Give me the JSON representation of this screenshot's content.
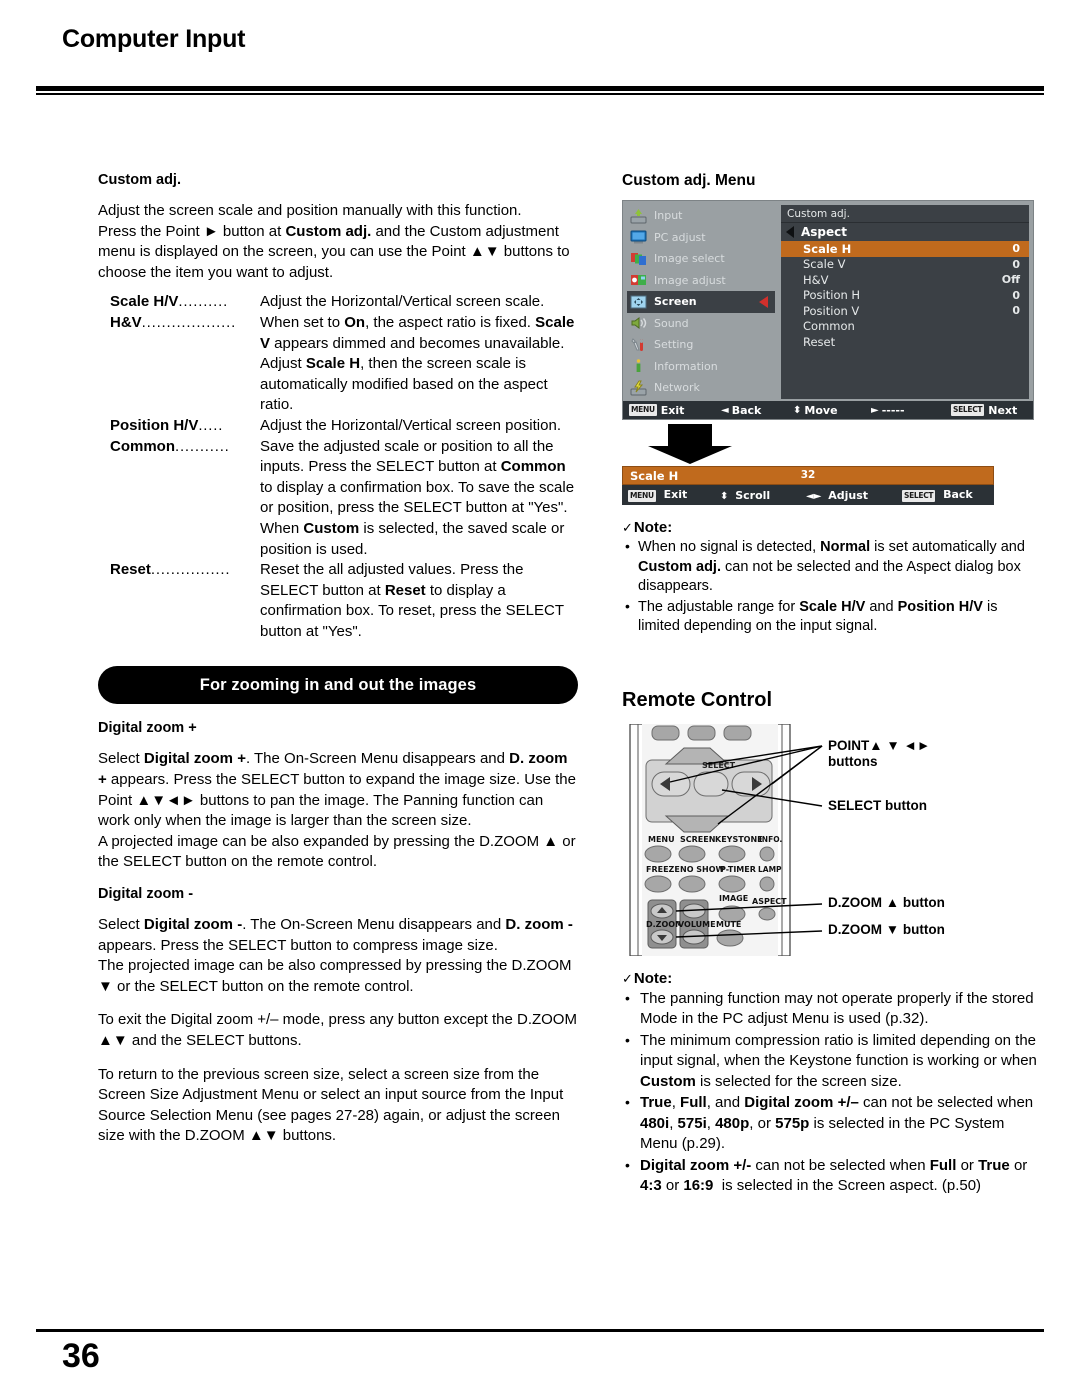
{
  "header": {
    "title": "Computer Input"
  },
  "footer": {
    "page_number": "36"
  },
  "left": {
    "custom_adj": {
      "heading": "Custom adj.",
      "p1": "Adjust the screen scale and position manually with this function.",
      "p2_pre": "Press the Point ► button at ",
      "p2_bold": "Custom adj.",
      "p2_post": " and the Custom adjustment menu is displayed on the screen, you can use the Point ▲▼ buttons to choose the item you want to adjust.",
      "items": [
        {
          "term": "Scale H/V",
          "dots": "..........",
          "desc": "Adjust the Horizontal/Vertical screen scale."
        },
        {
          "term": "H&V",
          "dots": "...................",
          "desc": "When set to On, the aspect ratio is fixed. Scale V appears dimmed and becomes unavailable. Adjust Scale H, then the screen scale is automatically modified based on the aspect ratio."
        },
        {
          "term": "Position H/V",
          "dots": ".....",
          "desc": "Adjust the Horizontal/Vertical screen position."
        },
        {
          "term": "Common",
          "dots": "...........",
          "desc": "Save the adjusted scale or position to all the inputs. Press the SELECT button at Common to display a confirmation box. To save the scale or position, press the SELECT button at \"Yes\". When Custom is selected, the saved scale or position is used."
        },
        {
          "term": "Reset",
          "dots": "................",
          "desc": "Reset the all adjusted values. Press the SELECT button at Reset to display a confirmation box. To reset, press the SELECT button at \"Yes\"."
        }
      ]
    },
    "banner": "For zooming in and out the images",
    "dzoom_plus": {
      "heading": "Digital zoom +",
      "p1": "Select Digital zoom +. The On-Screen Menu disappears and D. zoom + appears. Press the SELECT button to expand the image size. Use the Point ▲▼◄► buttons to pan the image. The Panning function can work only when the image is larger than the screen size.",
      "p2": "A projected image can be also expanded by pressing the D.ZOOM ▲ or the SELECT button on the remote control."
    },
    "dzoom_minus": {
      "heading": "Digital zoom -",
      "p1": "Select Digital zoom -. The On-Screen Menu disappears and D. zoom - appears. Press the SELECT button to compress image size.",
      "p2": "The projected image can be also compressed by pressing the D.ZOOM ▼ or the SELECT button on the remote control.",
      "p3": "To exit the Digital zoom +/– mode, press any button except the D.ZOOM ▲▼ and the SELECT buttons.",
      "p4": "To return to the previous screen size, select a screen size from the Screen Size Adjustment Menu or select an input source from the Input Source Selection Menu (see pages 27-28) again, or adjust the screen size with the D.ZOOM ▲▼ buttons."
    }
  },
  "right": {
    "osd_caption": "Custom adj. Menu",
    "osd": {
      "accent_color": "#c06a1d",
      "panel_color": "#3b4045",
      "frame_color": "#9aa0a3",
      "sidebar": [
        {
          "label": "Input",
          "icon": "input-icon",
          "active": false
        },
        {
          "label": "PC adjust",
          "icon": "monitor-icon",
          "active": false
        },
        {
          "label": "Image select",
          "icon": "image-select-icon",
          "active": false
        },
        {
          "label": "Image adjust",
          "icon": "image-adjust-icon",
          "active": false
        },
        {
          "label": "Screen",
          "icon": "screen-icon",
          "active": true
        },
        {
          "label": "Sound",
          "icon": "speaker-icon",
          "active": false
        },
        {
          "label": "Setting",
          "icon": "tools-icon",
          "active": false
        },
        {
          "label": "Information",
          "icon": "info-icon",
          "active": false
        },
        {
          "label": "Network",
          "icon": "network-icon",
          "active": false
        }
      ],
      "panel_title": "Custom adj.",
      "tab_label": "Aspect",
      "rows": [
        {
          "label": "Scale H",
          "value": "0",
          "selected": true
        },
        {
          "label": "Scale V",
          "value": "0",
          "selected": false
        },
        {
          "label": "H&V",
          "value": "Off",
          "selected": false
        },
        {
          "label": "Position H",
          "value": "0",
          "selected": false
        },
        {
          "label": "Position V",
          "value": "0",
          "selected": false
        },
        {
          "label": "Common",
          "value": "",
          "selected": false
        },
        {
          "label": "Reset",
          "value": "",
          "selected": false
        }
      ],
      "footbar": [
        {
          "key": "MENU",
          "glyph": "",
          "label": "Exit"
        },
        {
          "key": "",
          "glyph": "◄",
          "label": "Back"
        },
        {
          "key": "",
          "glyph": "⬍",
          "label": "Move"
        },
        {
          "key": "",
          "glyph": "►",
          "label": "-----"
        },
        {
          "key": "SELECT",
          "glyph": "",
          "label": "Next"
        }
      ]
    },
    "adjbar": {
      "label": "Scale H",
      "value": "32",
      "footbar": [
        {
          "key": "MENU",
          "glyph": "",
          "label": "Exit"
        },
        {
          "key": "",
          "glyph": "⬍",
          "label": "Scroll"
        },
        {
          "key": "",
          "glyph": "◄►",
          "label": "Adjust"
        },
        {
          "key": "SELECT",
          "glyph": "",
          "label": "Back"
        }
      ]
    },
    "note1": {
      "title": "Note:",
      "check": "✓",
      "items": [
        "When no signal is detected, Normal is set automatically and Custom adj. can not be selected and the Aspect dialog box disappears.",
        "The adjustable range for Scale H/V and Position H/V is limited depending on the input signal."
      ]
    },
    "remote_heading": "Remote Control",
    "remote": {
      "callouts": [
        {
          "id": "point",
          "text": "POINT▲ ▼ ◄►\nbuttons"
        },
        {
          "id": "select",
          "text": "SELECT button"
        },
        {
          "id": "dzu",
          "text": "D.ZOOM ▲ button"
        },
        {
          "id": "dzd",
          "text": "D.ZOOM ▼ button"
        }
      ],
      "button_labels": [
        "MENU",
        "SCREEN",
        "KEYSTONE",
        "INFO.",
        "FREEZE",
        "NO SHOW",
        "P-TIMER",
        "LAMP",
        "IMAGE",
        "ASPECT",
        "D.ZOOM",
        "VOLUME",
        "MUTE",
        "SELECT"
      ]
    },
    "note2": {
      "title": "Note:",
      "check": "✓",
      "items": [
        "The panning function may not operate properly if the stored Mode in the PC adjust Menu is used (p.32).",
        "The minimum compression ratio is limited depending on the input signal, when the Keystone function is working or when Custom is selected for the screen size.",
        "True, Full, and Digital zoom +/– can not be selected when 480i, 575i, 480p, or 575p is selected in the PC System Menu (p.29).",
        "Digital zoom +/- can not be selected when Full or True or 4:3 or 16:9  is selected in the Screen aspect. (p.50)"
      ]
    }
  }
}
